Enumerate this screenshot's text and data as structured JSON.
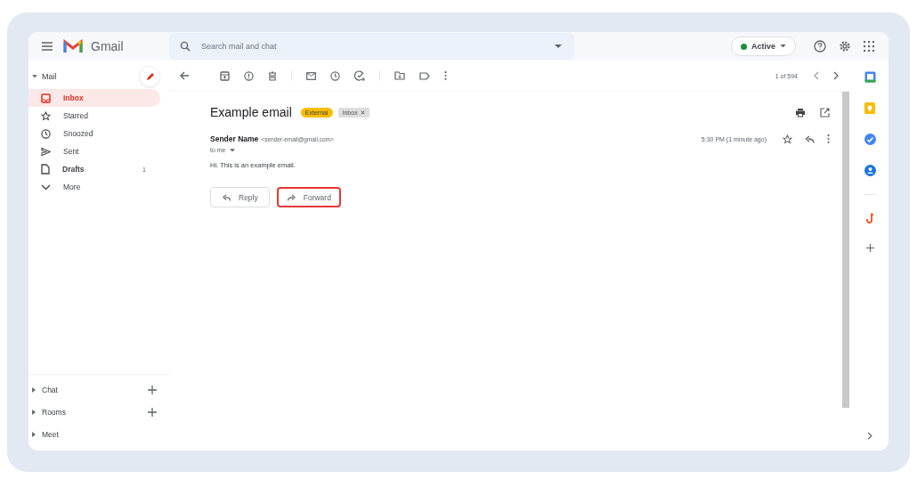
{
  "header": {
    "app_name": "Gmail",
    "search": {
      "placeholder": "Search mail and chat"
    },
    "status": {
      "label": "Active",
      "color": "#1e8e3e"
    }
  },
  "sidebar": {
    "section": "Mail",
    "items": [
      {
        "label": "Inbox",
        "kind": "inbox",
        "selected": true,
        "bold": true
      },
      {
        "label": "Starred",
        "kind": "star",
        "selected": false,
        "bold": false
      },
      {
        "label": "Snoozed",
        "kind": "clock",
        "selected": false,
        "bold": false
      },
      {
        "label": "Sent",
        "kind": "send",
        "selected": false,
        "bold": false
      },
      {
        "label": "Drafts",
        "kind": "file",
        "selected": false,
        "bold": true,
        "count": "1"
      },
      {
        "label": "More",
        "kind": "chevron",
        "selected": false,
        "bold": false
      }
    ],
    "bottom_sections": [
      {
        "label": "Chat",
        "addable": true
      },
      {
        "label": "Rooms",
        "addable": true
      },
      {
        "label": "Meet",
        "addable": false
      }
    ]
  },
  "toolbar": {
    "page_info": "1 of 594"
  },
  "message": {
    "subject": "Example email",
    "labels": [
      {
        "text": "External",
        "kind": "external"
      },
      {
        "text": "Inbox",
        "kind": "removable"
      }
    ],
    "sender_name": "Sender Name",
    "sender_email": "<sender-email@gmail.com>",
    "recipient": "to me",
    "time": "5:30 PM (1 minute ago)",
    "body": "Hi. This is an example email.",
    "actions": [
      {
        "label": "Reply",
        "kind": "reply",
        "highlighted": false
      },
      {
        "label": "Forward",
        "kind": "forward",
        "highlighted": true
      }
    ]
  }
}
